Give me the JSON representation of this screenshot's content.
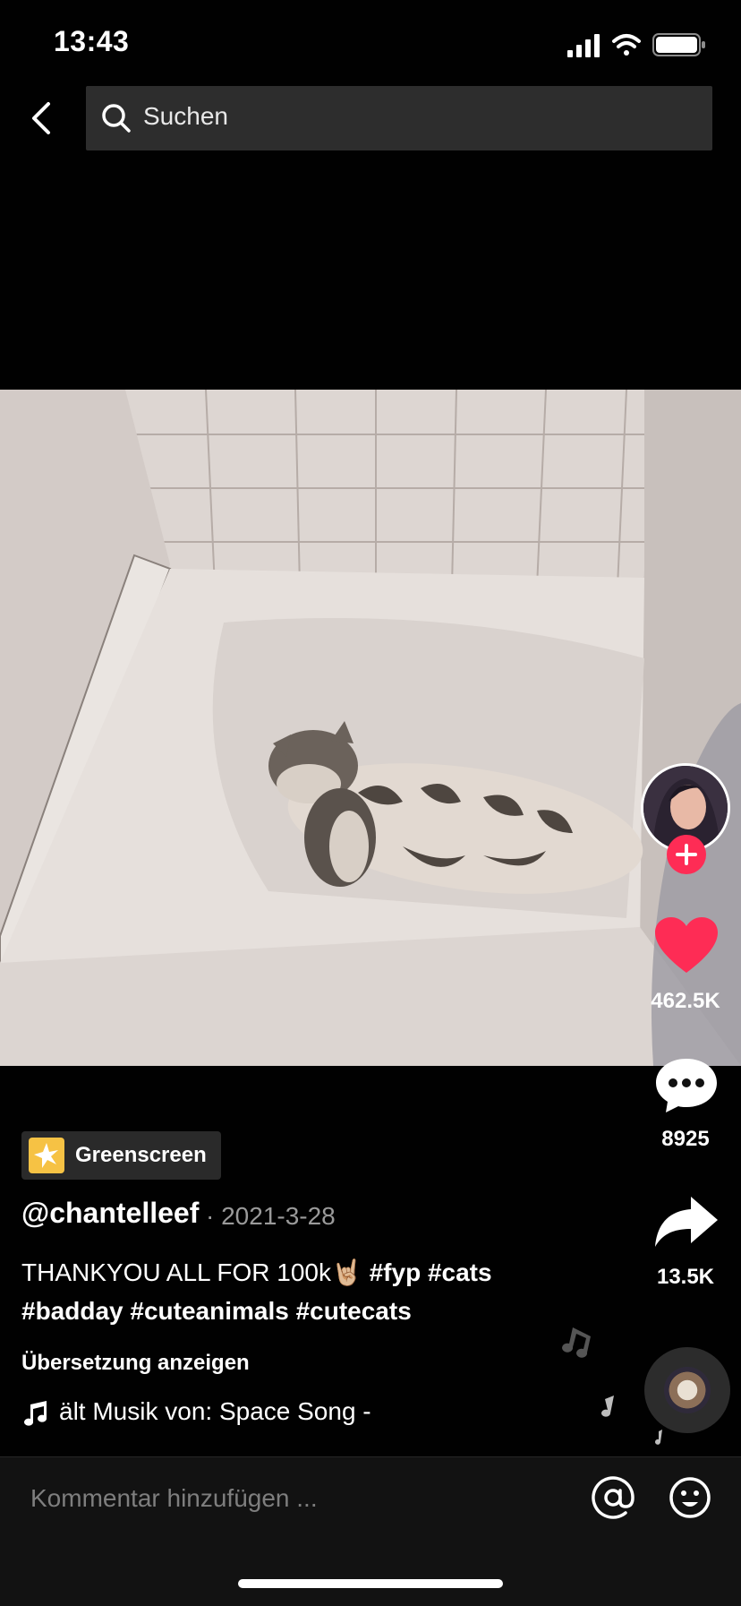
{
  "status_bar": {
    "time": "13:43"
  },
  "search": {
    "placeholder": "Suchen"
  },
  "video": {
    "description": "cat lying in bathtub"
  },
  "actions": {
    "likes": "462.5K",
    "comments": "8925",
    "shares": "13.5K",
    "accent_color": "#fe2c55"
  },
  "effect": {
    "label": "Greenscreen"
  },
  "post": {
    "username": "@chantelleef",
    "date": "· 2021-3-28",
    "caption_text": "THANKYOU ALL FOR 100k🤘🏼 ",
    "hashtags_line1": "#fyp #cats",
    "hashtags_line2": "#badday #cuteanimals #cutecats",
    "translate_label": "Übersetzung anzeigen",
    "music": "ält Musik von: Space Song -"
  },
  "comment_bar": {
    "placeholder": "Kommentar hinzufügen ..."
  }
}
